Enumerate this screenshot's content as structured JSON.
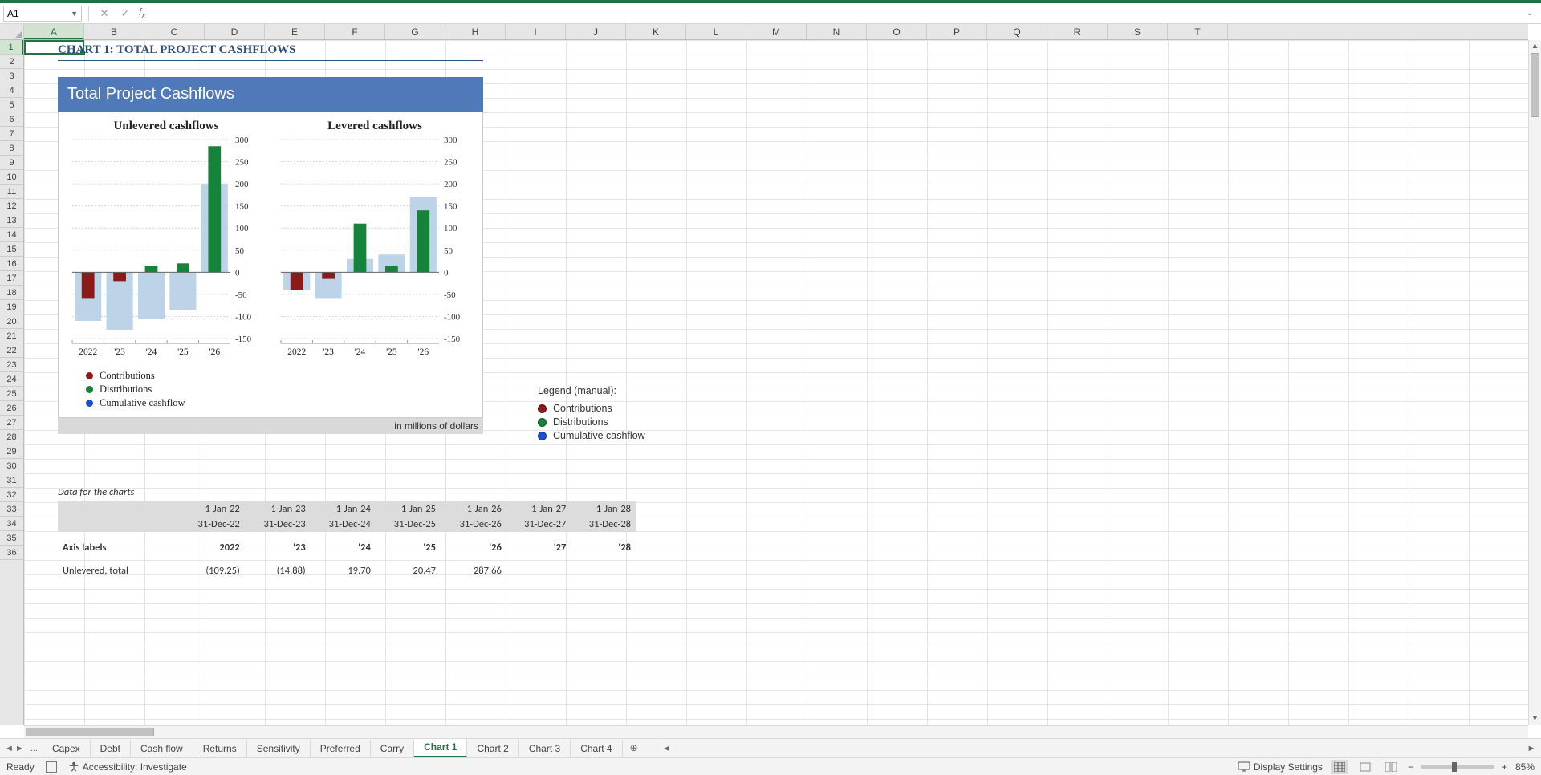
{
  "namebox": {
    "value": "A1"
  },
  "columns": [
    "A",
    "B",
    "C",
    "D",
    "E",
    "F",
    "G",
    "H",
    "I",
    "J",
    "K",
    "L",
    "M",
    "N",
    "O",
    "P",
    "Q",
    "R",
    "S",
    "T"
  ],
  "row_count": 36,
  "active": {
    "col": "A",
    "row": 1
  },
  "tabs": {
    "items": [
      "Capex",
      "Debt",
      "Cash flow",
      "Returns",
      "Sensitivity",
      "Preferred",
      "Carry",
      "Chart 1",
      "Chart 2",
      "Chart 3",
      "Chart 4"
    ],
    "active_index": 7,
    "overflow_label": "..."
  },
  "statusbar": {
    "ready": "Ready",
    "accessibility": "Accessibility: Investigate",
    "display": "Display Settings",
    "zoom": "85%"
  },
  "chart": {
    "heading": "CHART 1: TOTAL PROJECT CASHFLOWS",
    "panel_title": "Total Project Cashflows",
    "left_title": "Unlevered cashflows",
    "right_title": "Levered cashflows",
    "legend": {
      "a": "Contributions",
      "b": "Distributions",
      "c": "Cumulative cashflow"
    },
    "footer": "in millions of dollars",
    "ext_legend_title": "Legend (manual):"
  },
  "chart_data": [
    {
      "type": "bar",
      "title": "Unlevered cashflows",
      "categories": [
        "2022",
        "'23",
        "'24",
        "'25",
        "'26"
      ],
      "series": [
        {
          "name": "Contributions",
          "color": "#8b1a1a",
          "values": [
            -60,
            -20,
            0,
            0,
            0
          ]
        },
        {
          "name": "Distributions",
          "color": "#16833a",
          "values": [
            0,
            0,
            15,
            20,
            285
          ]
        },
        {
          "name": "Cumulative cashflow",
          "color": "#bcd3e8",
          "values": [
            -110,
            -130,
            -105,
            -85,
            200
          ]
        }
      ],
      "ylim": [
        -150,
        300
      ],
      "yticks": [
        -150,
        -100,
        -50,
        0,
        50,
        100,
        150,
        200,
        250,
        300
      ],
      "xlabel": "",
      "ylabel": ""
    },
    {
      "type": "bar",
      "title": "Levered cashflows",
      "categories": [
        "2022",
        "'23",
        "'24",
        "'25",
        "'26"
      ],
      "series": [
        {
          "name": "Contributions",
          "color": "#8b1a1a",
          "values": [
            -40,
            -15,
            0,
            0,
            0
          ]
        },
        {
          "name": "Distributions",
          "color": "#16833a",
          "values": [
            0,
            0,
            110,
            15,
            140
          ]
        },
        {
          "name": "Cumulative cashflow",
          "color": "#bcd3e8",
          "values": [
            -40,
            -60,
            30,
            40,
            170
          ]
        }
      ],
      "ylim": [
        -150,
        300
      ],
      "yticks": [
        -150,
        -100,
        -50,
        0,
        50,
        100,
        150,
        200,
        250,
        300
      ],
      "xlabel": "",
      "ylabel": ""
    }
  ],
  "data_section": {
    "heading": "Data for the charts",
    "start_dates": [
      "1-Jan-22",
      "1-Jan-23",
      "1-Jan-24",
      "1-Jan-25",
      "1-Jan-26",
      "1-Jan-27",
      "1-Jan-28"
    ],
    "end_dates": [
      "31-Dec-22",
      "31-Dec-23",
      "31-Dec-24",
      "31-Dec-25",
      "31-Dec-26",
      "31-Dec-27",
      "31-Dec-28"
    ],
    "axis_label_title": "Axis labels",
    "axis_labels": [
      "2022",
      "'23",
      "'24",
      "'25",
      "'26",
      "'27",
      "'28"
    ],
    "partial_row_label": "Unlevered, total",
    "partial_row_values": [
      "(109.25)",
      "(14.88)",
      "19.70",
      "20.47",
      "287.66",
      "",
      ""
    ]
  }
}
